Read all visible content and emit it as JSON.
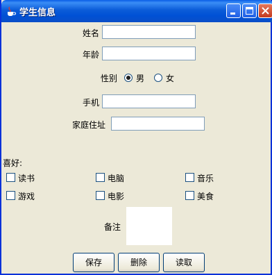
{
  "window": {
    "title": "学生信息"
  },
  "form": {
    "name_label": "姓名",
    "name_value": "",
    "age_label": "年龄",
    "age_value": "",
    "gender_label": "性别",
    "gender_options": [
      {
        "label": "男",
        "selected": true
      },
      {
        "label": "女",
        "selected": false
      }
    ],
    "phone_label": "手机",
    "phone_value": "",
    "address_label": "家庭住址",
    "address_value": ""
  },
  "hobbies": {
    "label": "喜好:",
    "items": [
      {
        "label": "读书",
        "checked": false
      },
      {
        "label": "电脑",
        "checked": false
      },
      {
        "label": "音乐",
        "checked": false
      },
      {
        "label": "游戏",
        "checked": false
      },
      {
        "label": "电影",
        "checked": false
      },
      {
        "label": "美食",
        "checked": false
      }
    ]
  },
  "notes": {
    "label": "备注",
    "value": ""
  },
  "buttons": {
    "save": "保存",
    "delete": "删除",
    "read": "读取"
  },
  "colors": {
    "titlebar": "#0a5ee6",
    "window_bg": "#ece9d8",
    "field_border": "#7f9db9"
  }
}
